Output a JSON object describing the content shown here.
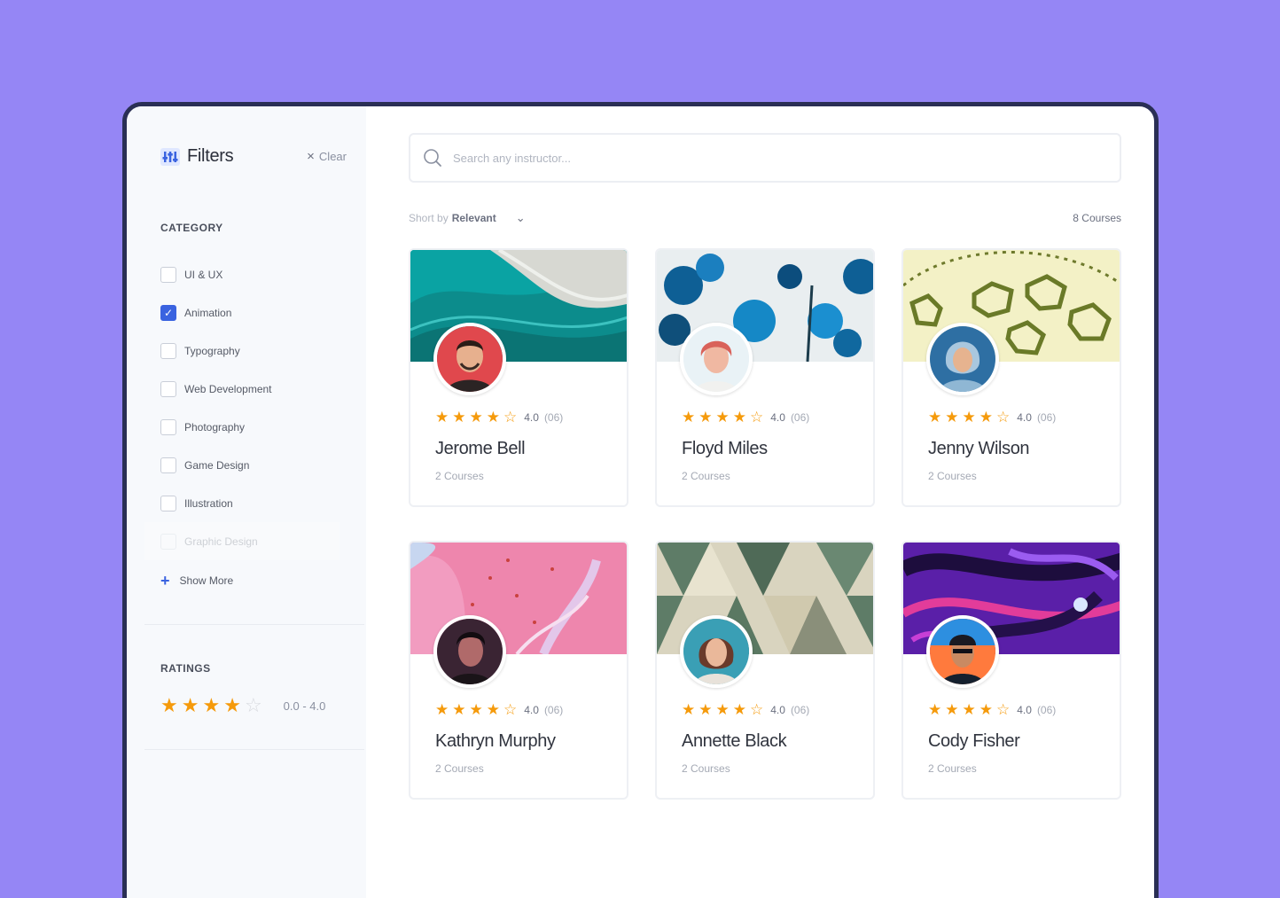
{
  "colors": {
    "page_background": "#9586f5",
    "accent": "#3a63e0",
    "star": "#f59a0b",
    "window_border": "#2a2f55"
  },
  "sidebar": {
    "title": "Filters",
    "title_icon": "filter-icon",
    "clear_label": "Clear",
    "category_title": "CATEGORY",
    "categories": [
      {
        "label": "UI & UX",
        "checked": false
      },
      {
        "label": "Animation",
        "checked": true
      },
      {
        "label": "Typography",
        "checked": false
      },
      {
        "label": "Web Development",
        "checked": false
      },
      {
        "label": "Photography",
        "checked": false
      },
      {
        "label": "Game Design",
        "checked": false
      },
      {
        "label": "Illustration",
        "checked": false
      },
      {
        "label": "Graphic Design",
        "checked": false
      }
    ],
    "show_more_label": "Show More",
    "ratings_title": "RATINGS",
    "ratings_stars": 4,
    "ratings_range": "0.0 - 4.0"
  },
  "main": {
    "search_placeholder": "Search any instructor...",
    "sort_prefix": "Short by",
    "sort_value": "Relevant",
    "course_count": "8 Courses",
    "instructors": [
      {
        "name": "Jerome Bell",
        "rating": "4.0",
        "reviews": "(06)",
        "stars": 4,
        "courses": "2 Courses",
        "cover": "teal-marble",
        "avatar": "man-red-bg"
      },
      {
        "name": "Floyd Miles",
        "rating": "4.0",
        "reviews": "(06)",
        "stars": 4,
        "courses": "2 Courses",
        "cover": "blue-flowers",
        "avatar": "woman-light-bg"
      },
      {
        "name": "Jenny Wilson",
        "rating": "4.0",
        "reviews": "(06)",
        "stars": 4,
        "courses": "2 Courses",
        "cover": "yellow-pattern",
        "avatar": "woman-blue-bg"
      },
      {
        "name": "Kathryn Murphy",
        "rating": "4.0",
        "reviews": "(06)",
        "stars": 4,
        "courses": "2 Courses",
        "cover": "pink-marble",
        "avatar": "man-dark-bg"
      },
      {
        "name": "Annette Black",
        "rating": "4.0",
        "reviews": "(06)",
        "stars": 4,
        "courses": "2 Courses",
        "cover": "green-triangles",
        "avatar": "woman-teal-bg"
      },
      {
        "name": "Cody Fisher",
        "rating": "4.0",
        "reviews": "(06)",
        "stars": 4,
        "courses": "2 Courses",
        "cover": "purple-swirl",
        "avatar": "man-neon-bg"
      }
    ]
  }
}
